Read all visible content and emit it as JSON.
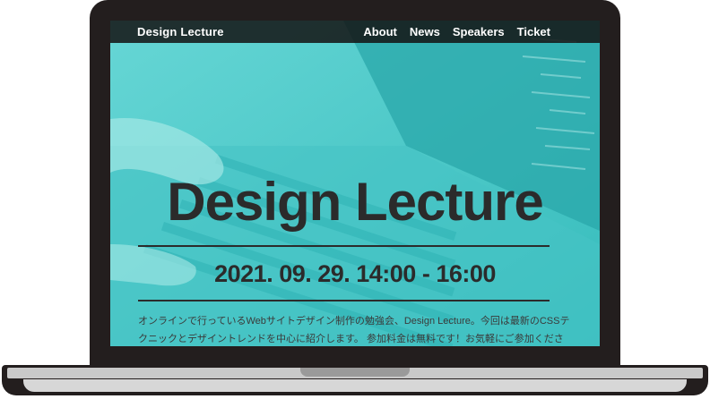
{
  "site": {
    "brand": "Design Lecture",
    "nav": [
      "About",
      "News",
      "Speakers",
      "Ticket"
    ]
  },
  "hero": {
    "title": "Design Lecture",
    "date": "2021. 09. 29. 14:00 - 16:00",
    "description": "オンラインで行っているWebサイトデザイン制作の勉強会、Design Lecture。今回は最新のCSSテクニックとデザイントレンドを中心に紹介します。 参加料金は無料です！お気軽にご参加ください。"
  },
  "colors": {
    "frame": "#231e1e",
    "screen_accent": "#3fc7c7",
    "text_dark": "#2b2b2b"
  }
}
